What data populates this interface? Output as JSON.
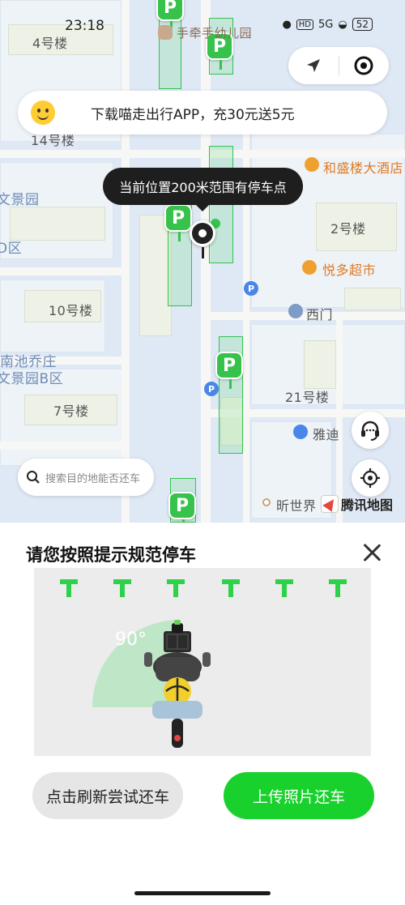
{
  "status_bar": {
    "time": "23:18",
    "network_label": "HD",
    "signal_label": "5G",
    "battery": "52"
  },
  "map": {
    "labels": {
      "building_4": "4号楼",
      "building_14": "14号楼",
      "wenjingyuan": "文景园",
      "d_district": "D区",
      "building_10": "10号楼",
      "nanchi_qiaozhuang": "南池乔庄",
      "wenjingyuan_b": "文景园B区",
      "building_7": "7号楼",
      "kindergarten": "手牵手幼儿园",
      "building_2": "2号楼",
      "building_21": "21号楼",
      "building_1_partial": "1号楼",
      "building_1_partial_b": "1号楼",
      "hotel": "和盛楼大酒店",
      "supermarket": "悦多超市",
      "west_gate": "西门",
      "yadi": "雅迪",
      "xinshijie": "昕世界",
      "fragment_a": "文景园",
      "fragment_b": "号楼"
    },
    "parking_label": "P",
    "parking_poi_label": "P",
    "tencent_logo_text": "腾讯地图",
    "colors": {
      "park_green": "#36c24b",
      "poi_blue": "#4a86e8",
      "poi_orange": "#f0a030"
    }
  },
  "top_controls": {
    "navigate_icon": "navigation-arrow-icon",
    "target_icon": "target-icon"
  },
  "promo": {
    "icon": "smiley-icon",
    "text": "下载喵走出行APP，充30元送5元"
  },
  "tooltip": {
    "text": "当前位置200米范围有停车点"
  },
  "side_buttons": {
    "support_icon": "headset-icon",
    "locate_icon": "crosshair-icon"
  },
  "search": {
    "placeholder": "搜索目的地能否还车"
  },
  "sheet": {
    "title": "请您按照提示规范停车",
    "illustration": {
      "angle_label": "90°",
      "marks": [
        "T",
        "T",
        "T",
        "T",
        "T",
        "T"
      ]
    },
    "refresh_button": "点击刷新尝试还车",
    "upload_button": "上传照片还车",
    "colors": {
      "primary_green": "#18d12c"
    }
  }
}
